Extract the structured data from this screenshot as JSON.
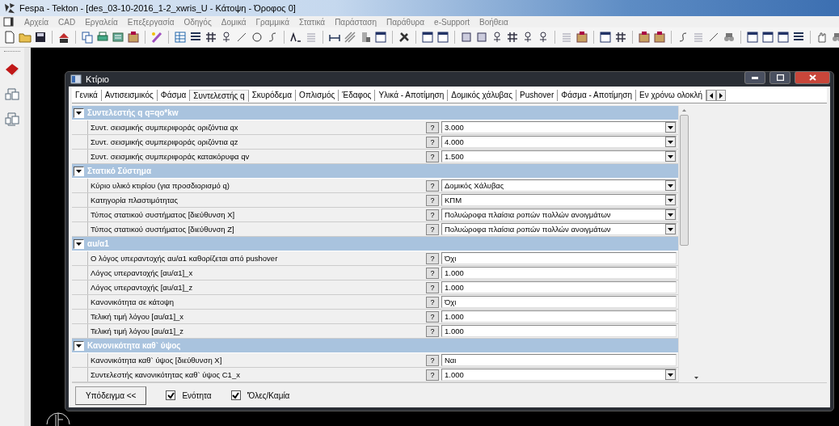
{
  "window": {
    "title": "Fespa - Tekton - [des_03-10-2016_1-2_xwris_U - Κάτοψη - Όροφος 0]"
  },
  "menu": [
    "Αρχεία",
    "CAD",
    "Εργαλεία",
    "Επεξεργασία",
    "Οδηγός",
    "Δομικά",
    "Γραμμικά",
    "Στατικά",
    "Παράσταση",
    "Παράθυρα",
    "e-Support",
    "Βοήθεια"
  ],
  "dialog": {
    "title": "Κτίριο",
    "tabs": [
      {
        "label": "Γενικά",
        "selected": false
      },
      {
        "label": "Αντισεισμικός",
        "selected": false
      },
      {
        "label": "Φάσμα",
        "selected": false
      },
      {
        "label": "Συντελεστής q",
        "selected": true
      },
      {
        "label": "Σκυρόδεμα",
        "selected": false
      },
      {
        "label": "Οπλισμός",
        "selected": false
      },
      {
        "label": "Έδαφος",
        "selected": false
      },
      {
        "label": "Υλικά - Αποτίμηση",
        "selected": false
      },
      {
        "label": "Δομικός χάλυβας",
        "selected": false
      },
      {
        "label": "Pushover",
        "selected": false
      },
      {
        "label": "Φάσμα - Αποτίμηση",
        "selected": false
      },
      {
        "label": "Εν χρόνω ολοκλή",
        "selected": false
      }
    ],
    "sections": [
      {
        "title": "Συντελεστής q  q=qo*kw",
        "rows": [
          {
            "label": "Συντ. σεισμικής συμπεριφοράς οριζόντια qx",
            "help": "?",
            "value": "3.000",
            "dropdown": true
          },
          {
            "label": "Συντ. σεισμικής συμπεριφοράς οριζόντια qz",
            "help": "?",
            "value": "4.000",
            "dropdown": true
          },
          {
            "label": "Συντ. σεισμικής συμπεριφοράς κατακόρυφα qv",
            "help": "?",
            "value": "1.500",
            "dropdown": true
          }
        ]
      },
      {
        "title": "Στατικό Σύστημα",
        "rows": [
          {
            "label": "Κύριο υλικό κτιρίου (για προσδιορισμό q)",
            "help": "?",
            "value": "Δομικός Χάλυβας",
            "dropdown": true
          },
          {
            "label": "Κατηγορία πλαστιμότητας",
            "help": "?",
            "value": "ΚΠΜ",
            "dropdown": true
          },
          {
            "label": "Τύπος στατικού συστήματος [διεύθυνση X]",
            "help": "?",
            "value": "Πολυώροφα πλαίσια ροπών πολλών ανοιγμάτων",
            "dropdown": true
          },
          {
            "label": "Τύπος στατικού συστήματος [διεύθυνση Z]",
            "help": "?",
            "value": "Πολυώροφα πλαίσια ροπών πολλών ανοιγμάτων",
            "dropdown": true
          }
        ]
      },
      {
        "title": "αu/α1",
        "rows": [
          {
            "label": "Ο λόγος υπεραντοχής αu/α1 καθορίζεται από pushover",
            "help": "?",
            "value": "Όχι",
            "dropdown": false
          },
          {
            "label": "Λόγος υπεραντοχής [αu/α1]_x",
            "help": "?",
            "value": "1.000",
            "dropdown": false
          },
          {
            "label": "Λόγος υπεραντοχής [αu/α1]_z",
            "help": "?",
            "value": "1.000",
            "dropdown": false
          },
          {
            "label": "Κανονικότητα σε κάτοψη",
            "help": "?",
            "value": "Όχι",
            "dropdown": false
          },
          {
            "label": "Τελική τιμή λόγου [αu/α1]_x",
            "help": "?",
            "value": "1.000",
            "dropdown": false
          },
          {
            "label": "Τελική τιμή λόγου [αu/α1]_z",
            "help": "?",
            "value": "1.000",
            "dropdown": false
          }
        ]
      },
      {
        "title": "Κανονικότητα καθ` ύψος",
        "rows": [
          {
            "label": "Κανονικότητα καθ` ύψος [διεύθυνση X]",
            "help": "?",
            "value": "Ναι",
            "dropdown": false
          },
          {
            "label": "Συντελεστής κανονικότητας καθ` ύψος C1_x",
            "help": "?",
            "value": "1.000",
            "dropdown": true
          }
        ]
      }
    ],
    "footer": {
      "button": "Υπόδειγμα <<",
      "checkboxes": [
        {
          "label": "Ενότητα",
          "checked": true
        },
        {
          "label": "'Όλες/Καμία",
          "checked": true
        }
      ]
    }
  }
}
